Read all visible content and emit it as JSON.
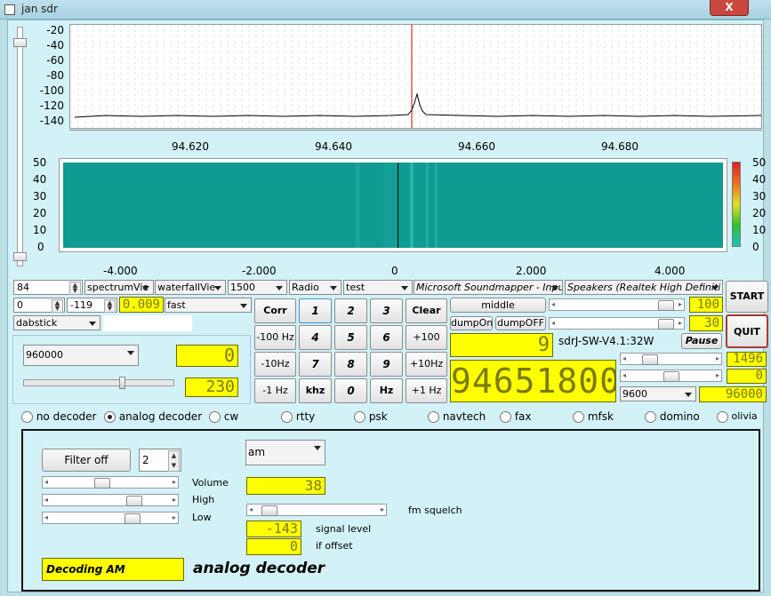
{
  "window": {
    "title": "jan sdr",
    "close_glyph": "X"
  },
  "spectrum": {
    "y_ticks": [
      "-20",
      "-40",
      "-60",
      "-80",
      "-100",
      "-120",
      "-140"
    ],
    "x_ticks": [
      "94.620",
      "94.640",
      "94.660",
      "94.680"
    ],
    "marker_color": "#d01010",
    "trace_color": "#000000"
  },
  "waterfall": {
    "y_ticks": [
      "50",
      "40",
      "30",
      "20",
      "10",
      "0"
    ],
    "x_ticks": [
      "-4.000",
      "-2.000",
      "0",
      "2.000",
      "4.000"
    ],
    "color_scale": [
      "50",
      "40",
      "30",
      "20",
      "10",
      "0"
    ],
    "base_color": "#0f9a92"
  },
  "row1": {
    "spin_value": "84",
    "spectrum_view": "spectrumVie",
    "waterfall_view": "waterfallVie",
    "rate": "1500",
    "mode": "Radio",
    "test": "test",
    "input_device": "Microsoft Soundmapper - Input",
    "output_device": "Speakers (Realtek High Definiti"
  },
  "row2": {
    "spin_a": "0",
    "spin_b": "-119",
    "lcd": "0.009",
    "speed": "fast",
    "middle_label": "middle",
    "lcd_right": "100"
  },
  "row3": {
    "device": "dabstick",
    "dump_on": "dumpOn",
    "dump_off": "dumpOFF",
    "lcd_right": "30"
  },
  "keypad": {
    "corr": "Corr",
    "k1": "1",
    "k2": "2",
    "k3": "3",
    "clear": "Clear",
    "m100": "-100 Hz",
    "k4": "4",
    "k5": "5",
    "k6": "6",
    "p100": "+100 Hz",
    "m10": "-10Hz",
    "k7": "7",
    "k8": "8",
    "k9": "9",
    "p10": "+10Hz",
    "m1": "-1 Hz",
    "khz": "khz",
    "k0": "0",
    "hz": "Hz",
    "p1": "+1 Hz"
  },
  "left": {
    "samplerate": "960000",
    "lcd_top": "0",
    "lcd_bottom": "230",
    "gain_level": 0.72
  },
  "center": {
    "lcd_small": "9",
    "version": "sdrJ-SW-V4.1:32W",
    "pause": "Pause",
    "frequency": "94651800",
    "baud": "9600",
    "lcd_r1": "1496",
    "lcd_r2": "0",
    "lcd_r3": "96000"
  },
  "buttons": {
    "start": "START",
    "quit": "QUIT"
  },
  "decoders": [
    "no decoder",
    "analog decoder",
    "cw",
    "rtty",
    "psk",
    "navtech",
    "fax",
    "mfsk",
    "domino",
    "olivia"
  ],
  "selected_decoder": "analog decoder",
  "panel": {
    "filter_button": "Filter off",
    "filter_spin": "2",
    "mode": "am",
    "volume_label": "Volume",
    "high_label": "High",
    "low_label": "Low",
    "lcd_volume": "38",
    "squelch_label": "fm squelch",
    "lcd_signal": "-143",
    "signal_label": "signal level",
    "lcd_offset": "0",
    "offset_label": "if offset",
    "status": "Decoding AM",
    "title": "analog decoder"
  }
}
